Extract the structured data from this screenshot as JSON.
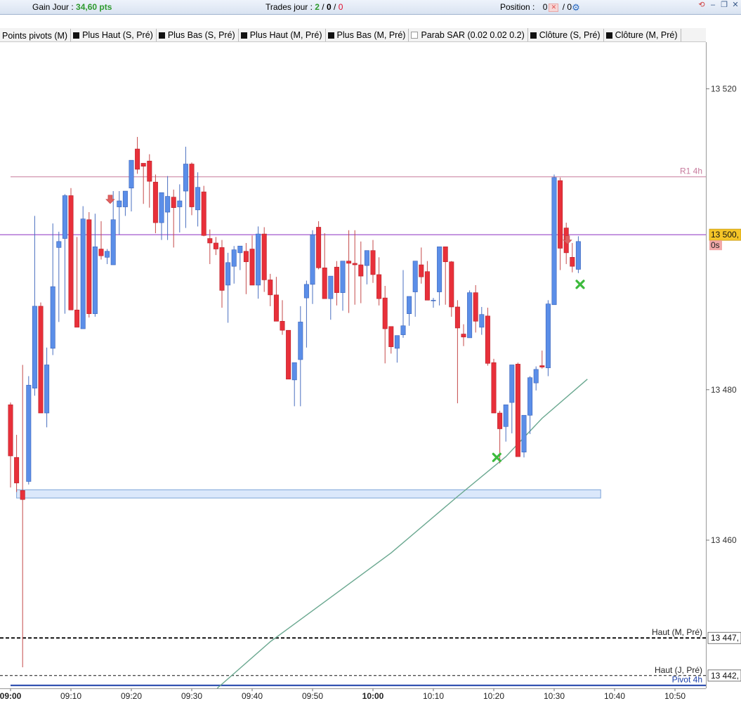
{
  "header": {
    "gain_label": "Gain Jour :",
    "gain_value": "34,60 pts",
    "trades_label": "Trades jour :",
    "trades_won": "2",
    "trades_sep1": "/",
    "trades_neutral": "0",
    "trades_sep2": "/",
    "trades_lost": "0",
    "position_label": "Position :",
    "position_value": "0",
    "position_sep": "/ 0"
  },
  "legend": [
    {
      "label": "Points pivots (M)",
      "swatch": "none"
    },
    {
      "label": "Plus Haut (S, Pré)",
      "swatch": "black"
    },
    {
      "label": "Plus Bas (S, Pré)",
      "swatch": "black"
    },
    {
      "label": "Plus Haut (M, Pré)",
      "swatch": "black"
    },
    {
      "label": "Plus Bas (M, Pré)",
      "swatch": "black"
    },
    {
      "label": "Parab SAR (0.02 0.02 0.2)",
      "swatch": "empty"
    },
    {
      "label": "Clôture (S, Pré)",
      "swatch": "black"
    },
    {
      "label": "Clôture (M, Pré)",
      "swatch": "black"
    }
  ],
  "colors": {
    "bull": "#5b8ee8",
    "bear": "#e8303a",
    "wick": "#c44a4a",
    "pivot": "#b06a90",
    "current_line": "#8a2ec0",
    "ma": "#6aa890",
    "marker_green": "#3cba3c",
    "marker_red": "#e06060",
    "zone_fill": "#dbe8fb",
    "zone_stroke": "#7ba3d8"
  },
  "chart_data": {
    "type": "candlestick",
    "timeframe": "1 minute",
    "x_ticks": [
      "09:00",
      "09:10",
      "09:20",
      "09:30",
      "09:40",
      "09:50",
      "10:00",
      "10:10",
      "10:20",
      "10:30",
      "10:40",
      "10:50"
    ],
    "y_ticks": [
      "13 520",
      "13 480",
      "13 460"
    ],
    "ylim": [
      13440.3,
      13526.2
    ],
    "price_label": "13 500,",
    "countdown": "0s",
    "candles": [
      {
        "t": 0,
        "o": 13478.0,
        "h": 13478.3,
        "l": 13467.0,
        "c": 13471.2
      },
      {
        "t": 1,
        "o": 13471.0,
        "h": 13474.0,
        "l": 13466.4,
        "c": 13467.6
      },
      {
        "t": 2,
        "o": 13466.6,
        "h": 13483.3,
        "l": 13443.1,
        "c": 13465.4
      },
      {
        "t": 3,
        "o": 13467.8,
        "h": 13481.8,
        "l": 13467.4,
        "c": 13480.6
      },
      {
        "t": 4,
        "o": 13480.2,
        "h": 13503.1,
        "l": 13479.2,
        "c": 13491.1
      },
      {
        "t": 5,
        "o": 13491.1,
        "h": 13491.6,
        "l": 13478.1,
        "c": 13476.9
      },
      {
        "t": 6,
        "o": 13476.9,
        "h": 13485.6,
        "l": 13475.0,
        "c": 13483.3
      },
      {
        "t": 7,
        "o": 13485.5,
        "h": 13502.1,
        "l": 13484.6,
        "c": 13493.7
      },
      {
        "t": 8,
        "o": 13498.9,
        "h": 13501.0,
        "l": 13489.0,
        "c": 13499.7
      },
      {
        "t": 9,
        "o": 13500.1,
        "h": 13506.0,
        "l": 13490.1,
        "c": 13505.8
      },
      {
        "t": 10,
        "o": 13505.8,
        "h": 13506.8,
        "l": 13490.6,
        "c": 13490.6
      },
      {
        "t": 11,
        "o": 13490.6,
        "h": 13500.3,
        "l": 13489.0,
        "c": 13488.3
      },
      {
        "t": 12,
        "o": 13488.1,
        "h": 13504.4,
        "l": 13488.1,
        "c": 13502.7
      },
      {
        "t": 13,
        "o": 13502.6,
        "h": 13503.6,
        "l": 13489.6,
        "c": 13490.1
      },
      {
        "t": 14,
        "o": 13490.1,
        "h": 13503.4,
        "l": 13489.7,
        "c": 13499.0
      },
      {
        "t": 15,
        "o": 13498.7,
        "h": 13502.4,
        "l": 13497.3,
        "c": 13497.8
      },
      {
        "t": 16,
        "o": 13497.6,
        "h": 13498.7,
        "l": 13496.7,
        "c": 13498.4
      },
      {
        "t": 17,
        "o": 13496.6,
        "h": 13506.4,
        "l": 13496.6,
        "c": 13502.6
      },
      {
        "t": 18,
        "o": 13504.3,
        "h": 13506.4,
        "l": 13500.6,
        "c": 13505.1
      },
      {
        "t": 19,
        "o": 13504.3,
        "h": 13505.6,
        "l": 13503.1,
        "c": 13506.4
      },
      {
        "t": 20,
        "o": 13506.8,
        "h": 13510.5,
        "l": 13503.7,
        "c": 13510.5
      },
      {
        "t": 21,
        "o": 13512.0,
        "h": 13513.6,
        "l": 13508.7,
        "c": 13509.3
      },
      {
        "t": 22,
        "o": 13510.1,
        "h": 13509.8,
        "l": 13504.7,
        "c": 13509.7
      },
      {
        "t": 23,
        "o": 13510.4,
        "h": 13511.3,
        "l": 13504.2,
        "c": 13507.7
      },
      {
        "t": 24,
        "o": 13507.6,
        "h": 13508.6,
        "l": 13500.8,
        "c": 13502.2
      },
      {
        "t": 25,
        "o": 13502.2,
        "h": 13503.9,
        "l": 13499.9,
        "c": 13506.2
      },
      {
        "t": 26,
        "o": 13503.6,
        "h": 13508.4,
        "l": 13499.9,
        "c": 13505.7
      },
      {
        "t": 27,
        "o": 13505.6,
        "h": 13506.6,
        "l": 13498.9,
        "c": 13504.2
      },
      {
        "t": 28,
        "o": 13504.3,
        "h": 13507.3,
        "l": 13500.9,
        "c": 13505.1
      },
      {
        "t": 29,
        "o": 13506.4,
        "h": 13512.3,
        "l": 13501.5,
        "c": 13510.0
      },
      {
        "t": 30,
        "o": 13510.0,
        "h": 13510.2,
        "l": 13503.2,
        "c": 13504.3
      },
      {
        "t": 31,
        "o": 13503.9,
        "h": 13508.9,
        "l": 13501.7,
        "c": 13506.9
      },
      {
        "t": 32,
        "o": 13506.3,
        "h": 13507.1,
        "l": 13500.4,
        "c": 13500.5
      },
      {
        "t": 33,
        "o": 13500.1,
        "h": 13501.3,
        "l": 13496.7,
        "c": 13499.5
      },
      {
        "t": 34,
        "o": 13499.5,
        "h": 13500.3,
        "l": 13497.9,
        "c": 13498.7
      },
      {
        "t": 35,
        "o": 13498.9,
        "h": 13499.9,
        "l": 13490.9,
        "c": 13493.2
      },
      {
        "t": 36,
        "o": 13493.9,
        "h": 13498.2,
        "l": 13488.9,
        "c": 13496.9
      },
      {
        "t": 37,
        "o": 13496.4,
        "h": 13499.1,
        "l": 13494.1,
        "c": 13498.6
      },
      {
        "t": 38,
        "o": 13498.2,
        "h": 13498.8,
        "l": 13495.9,
        "c": 13499.1
      },
      {
        "t": 39,
        "o": 13498.4,
        "h": 13499.5,
        "l": 13492.7,
        "c": 13497.0
      },
      {
        "t": 40,
        "o": 13498.7,
        "h": 13500.5,
        "l": 13495.7,
        "c": 13493.9
      },
      {
        "t": 41,
        "o": 13493.9,
        "h": 13501.7,
        "l": 13492.1,
        "c": 13500.7
      },
      {
        "t": 42,
        "o": 13500.7,
        "h": 13501.6,
        "l": 13493.0,
        "c": 13494.6
      },
      {
        "t": 43,
        "o": 13494.6,
        "h": 13495.4,
        "l": 13491.1,
        "c": 13492.6
      },
      {
        "t": 44,
        "o": 13492.6,
        "h": 13495.0,
        "l": 13490.1,
        "c": 13489.1
      },
      {
        "t": 45,
        "o": 13489.1,
        "h": 13491.9,
        "l": 13487.3,
        "c": 13487.9
      },
      {
        "t": 46,
        "o": 13487.9,
        "h": 13487.9,
        "l": 13481.5,
        "c": 13481.4
      },
      {
        "t": 47,
        "o": 13481.3,
        "h": 13482.3,
        "l": 13477.8,
        "c": 13483.6
      },
      {
        "t": 48,
        "o": 13484.0,
        "h": 13491.1,
        "l": 13477.8,
        "c": 13489.0
      },
      {
        "t": 49,
        "o": 13492.2,
        "h": 13494.5,
        "l": 13485.6,
        "c": 13494.0
      },
      {
        "t": 50,
        "o": 13494.0,
        "h": 13501.2,
        "l": 13491.4,
        "c": 13500.6
      },
      {
        "t": 51,
        "o": 13501.6,
        "h": 13502.4,
        "l": 13496.0,
        "c": 13496.2
      },
      {
        "t": 52,
        "o": 13496.2,
        "h": 13500.8,
        "l": 13493.3,
        "c": 13492.1
      },
      {
        "t": 53,
        "o": 13492.1,
        "h": 13493.4,
        "l": 13489.3,
        "c": 13495.1
      },
      {
        "t": 54,
        "o": 13496.3,
        "h": 13497.1,
        "l": 13491.2,
        "c": 13492.9
      },
      {
        "t": 55,
        "o": 13492.9,
        "h": 13496.8,
        "l": 13490.5,
        "c": 13497.1
      },
      {
        "t": 56,
        "o": 13497.1,
        "h": 13501.2,
        "l": 13490.2,
        "c": 13496.8
      },
      {
        "t": 57,
        "o": 13496.8,
        "h": 13501.2,
        "l": 13491.3,
        "c": 13496.6
      },
      {
        "t": 58,
        "o": 13496.6,
        "h": 13499.7,
        "l": 13491.5,
        "c": 13495.1
      },
      {
        "t": 59,
        "o": 13496.5,
        "h": 13497.6,
        "l": 13494.0,
        "c": 13498.5
      },
      {
        "t": 60,
        "o": 13498.5,
        "h": 13499.9,
        "l": 13494.2,
        "c": 13495.3
      },
      {
        "t": 61,
        "o": 13495.3,
        "h": 13497.6,
        "l": 13491.2,
        "c": 13492.1
      },
      {
        "t": 62,
        "o": 13492.2,
        "h": 13493.8,
        "l": 13483.5,
        "c": 13488.1
      },
      {
        "t": 63,
        "o": 13488.4,
        "h": 13486.8,
        "l": 13484.8,
        "c": 13485.7
      },
      {
        "t": 64,
        "o": 13485.5,
        "h": 13486.6,
        "l": 13483.6,
        "c": 13487.2
      },
      {
        "t": 65,
        "o": 13487.3,
        "h": 13495.9,
        "l": 13486.9,
        "c": 13488.5
      },
      {
        "t": 66,
        "o": 13490.1,
        "h": 13491.7,
        "l": 13488.5,
        "c": 13492.4
      },
      {
        "t": 67,
        "o": 13493.0,
        "h": 13496.7,
        "l": 13489.7,
        "c": 13497.1
      },
      {
        "t": 68,
        "o": 13496.6,
        "h": 13498.9,
        "l": 13494.1,
        "c": 13495.0
      },
      {
        "t": 69,
        "o": 13495.7,
        "h": 13497.1,
        "l": 13492.1,
        "c": 13491.9
      },
      {
        "t": 70,
        "o": 13491.9,
        "h": 13492.2,
        "l": 13490.9,
        "c": 13491.9
      },
      {
        "t": 71,
        "o": 13493.0,
        "h": 13498.3,
        "l": 13491.2,
        "c": 13499.0
      },
      {
        "t": 72,
        "o": 13499.0,
        "h": 13499.0,
        "l": 13491.3,
        "c": 13497.0
      },
      {
        "t": 73,
        "o": 13497.0,
        "h": 13497.1,
        "l": 13489.7,
        "c": 13491.0
      },
      {
        "t": 74,
        "o": 13491.0,
        "h": 13491.9,
        "l": 13478.2,
        "c": 13488.2
      },
      {
        "t": 75,
        "o": 13487.4,
        "h": 13488.7,
        "l": 13485.8,
        "c": 13487.0
      },
      {
        "t": 76,
        "o": 13486.9,
        "h": 13493.2,
        "l": 13486.9,
        "c": 13492.9
      },
      {
        "t": 77,
        "o": 13492.9,
        "h": 13493.9,
        "l": 13487.6,
        "c": 13489.1
      },
      {
        "t": 78,
        "o": 13488.3,
        "h": 13491.0,
        "l": 13487.3,
        "c": 13490.0
      },
      {
        "t": 79,
        "o": 13489.8,
        "h": 13490.9,
        "l": 13483.2,
        "c": 13483.5
      },
      {
        "t": 80,
        "o": 13483.6,
        "h": 13484.1,
        "l": 13476.9,
        "c": 13476.9
      },
      {
        "t": 81,
        "o": 13476.9,
        "h": 13477.2,
        "l": 13470.2,
        "c": 13474.8
      },
      {
        "t": 82,
        "o": 13475.1,
        "h": 13476.8,
        "l": 13473.1,
        "c": 13478.0
      },
      {
        "t": 83,
        "o": 13478.3,
        "h": 13483.3,
        "l": 13474.2,
        "c": 13483.3
      },
      {
        "t": 84,
        "o": 13483.4,
        "h": 13483.6,
        "l": 13472.5,
        "c": 13471.1
      },
      {
        "t": 85,
        "o": 13471.7,
        "h": 13472.8,
        "l": 13471.0,
        "c": 13476.6
      },
      {
        "t": 86,
        "o": 13476.6,
        "h": 13481.8,
        "l": 13474.1,
        "c": 13481.6
      },
      {
        "t": 87,
        "o": 13480.9,
        "h": 13483.1,
        "l": 13479.9,
        "c": 13482.7
      },
      {
        "t": 88,
        "o": 13483.2,
        "h": 13485.2,
        "l": 13482.8,
        "c": 13483.0
      },
      {
        "t": 89,
        "o": 13482.9,
        "h": 13491.9,
        "l": 13481.8,
        "c": 13491.4
      },
      {
        "t": 90,
        "o": 13491.3,
        "h": 13508.6,
        "l": 13491.3,
        "c": 13508.2
      },
      {
        "t": 91,
        "o": 13507.8,
        "h": 13508.2,
        "l": 13495.9,
        "c": 13498.8
      },
      {
        "t": 92,
        "o": 13501.5,
        "h": 13502.2,
        "l": 13496.7,
        "c": 13498.2
      },
      {
        "t": 93,
        "o": 13497.6,
        "h": 13499.5,
        "l": 13495.6,
        "c": 13496.4
      },
      {
        "t": 94,
        "o": 13496.0,
        "h": 13500.4,
        "l": 13495.5,
        "c": 13499.7
      }
    ],
    "horizontal_lines": [
      {
        "label": "R1 4h",
        "value": 13508.3,
        "style": "solid",
        "color": "#c77a9c"
      },
      {
        "label": "",
        "value": 13500.6,
        "style": "solid",
        "color": "#8a2ec0"
      },
      {
        "label": "Haut (M, Pré)",
        "value": 13447.0,
        "style": "dashed",
        "color": "#111"
      },
      {
        "label": "Haut (J, Pré)",
        "value": 13442.0,
        "style": "dashed",
        "color": "#111"
      },
      {
        "label": "Pivot 4h",
        "value": 13440.7,
        "style": "solid",
        "color": "#1a3fa8"
      }
    ],
    "right_labels": [
      {
        "text": "13 447,",
        "value": 13447.0
      },
      {
        "text": "13 442,",
        "value": 13442.0
      }
    ],
    "zone": {
      "from_t": 1,
      "to_t": 97.7,
      "y_high": 13466.7,
      "y_low": 13465.6
    },
    "moving_average": [
      {
        "t": 34.2,
        "v": 13440.3
      },
      {
        "t": 43,
        "v": 13446.5
      },
      {
        "t": 52,
        "v": 13451.8
      },
      {
        "t": 63,
        "v": 13458.3
      },
      {
        "t": 74,
        "v": 13465.8
      },
      {
        "t": 82,
        "v": 13471.1
      },
      {
        "t": 88,
        "v": 13476.2
      },
      {
        "t": 95.5,
        "v": 13481.4
      }
    ],
    "markers": [
      {
        "kind": "sell-arrow",
        "t": 16.5,
        "v": 13505.3
      },
      {
        "kind": "sell-arrow",
        "t": 92.2,
        "v": 13499.9
      },
      {
        "kind": "buy-cross",
        "t": 80.5,
        "v": 13471.0
      },
      {
        "kind": "buy-cross",
        "t": 94.3,
        "v": 13494.0
      }
    ]
  }
}
